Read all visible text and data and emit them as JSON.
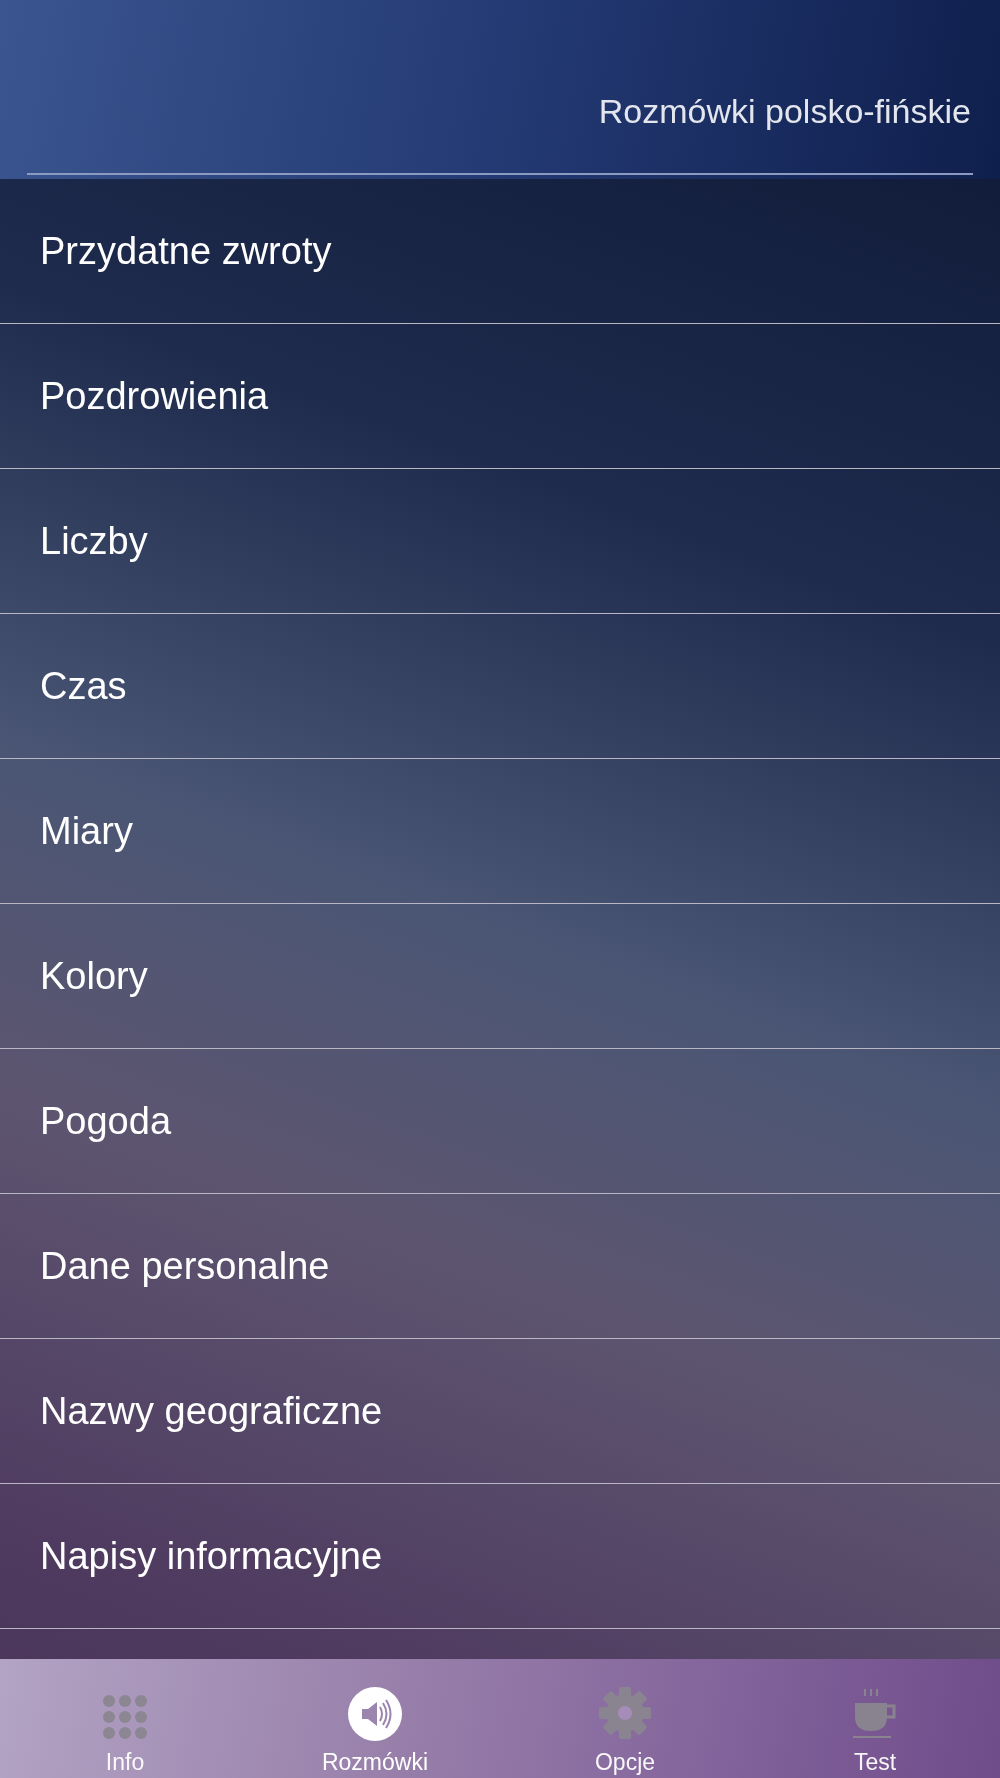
{
  "header": {
    "title": "Rozmówki polsko-fińskie"
  },
  "categories": [
    {
      "label": "Przydatne zwroty"
    },
    {
      "label": "Pozdrowienia"
    },
    {
      "label": "Liczby"
    },
    {
      "label": "Czas"
    },
    {
      "label": "Miary"
    },
    {
      "label": "Kolory"
    },
    {
      "label": "Pogoda"
    },
    {
      "label": "Dane personalne"
    },
    {
      "label": "Nazwy geograficzne"
    },
    {
      "label": "Napisy informacyjne"
    }
  ],
  "tab_bar": [
    {
      "kind": "grid",
      "label": "Info",
      "selected": false
    },
    {
      "kind": "speaker",
      "label": "Rozmówki",
      "selected": true
    },
    {
      "kind": "gear",
      "label": "Opcje",
      "selected": false
    },
    {
      "kind": "cup",
      "label": "Test",
      "selected": false
    }
  ]
}
